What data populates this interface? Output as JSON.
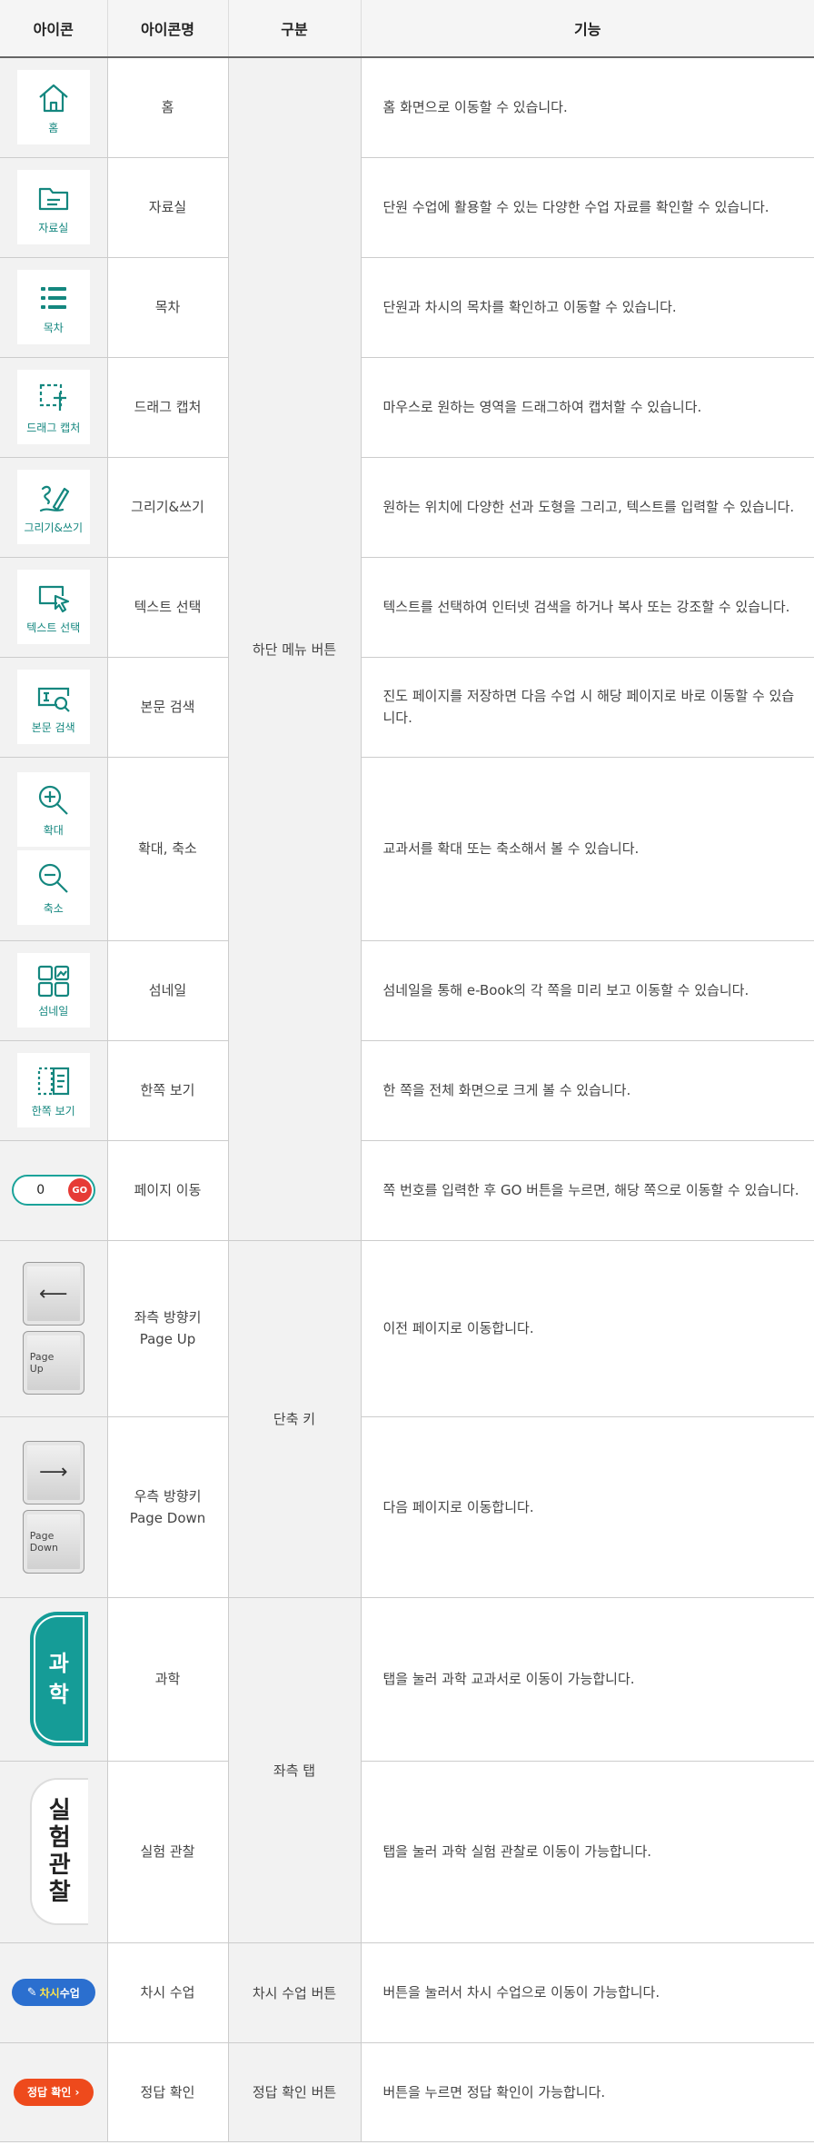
{
  "headers": {
    "icon": "아이콘",
    "name": "아이콘명",
    "category": "구분",
    "function": "기능"
  },
  "categories": {
    "bottom_menu": "하단 메뉴 버튼",
    "shortcut": "단축 키",
    "left_tab": "좌측 탭",
    "lesson": "차시 수업 버튼",
    "answer": "정답 확인 버튼"
  },
  "rows": [
    {
      "icon_label": "홈",
      "name": "홈",
      "desc": "홈 화면으로 이동할 수 있습니다.",
      "icon": "home-icon"
    },
    {
      "icon_label": "자료실",
      "name": "자료실",
      "desc": "단원 수업에 활용할 수 있는 다양한 수업 자료를 확인할 수 있습니다.",
      "icon": "folder-icon"
    },
    {
      "icon_label": "목차",
      "name": "목차",
      "desc": "단원과 차시의 목차를 확인하고 이동할 수 있습니다.",
      "icon": "list-icon"
    },
    {
      "icon_label": "드래그 캡처",
      "name": "드래그 캡처",
      "desc": "마우스로 원하는 영역을 드래그하여 캡처할 수 있습니다.",
      "icon": "crop-icon"
    },
    {
      "icon_label": "그리기&쓰기",
      "name": "그리기&쓰기",
      "desc": "원하는 위치에 다양한 선과 도형을 그리고, 텍스트를 입력할 수 있습니다.",
      "icon": "draw-icon"
    },
    {
      "icon_label": "텍스트 선택",
      "name": "텍스트 선택",
      "desc": "텍스트를 선택하여 인터넷 검색을 하거나 복사 또는 강조할 수 있습니다.",
      "icon": "text-select-icon"
    },
    {
      "icon_label": "본문 검색",
      "name": "본문 검색",
      "desc": "진도 페이지를 저장하면 다음 수업 시 해당 페이지로 바로 이동할 수 있습니다.",
      "icon": "search-text-icon"
    },
    {
      "icon_label": "확대",
      "icon_label2": "축소",
      "name": "확대, 축소",
      "desc": "교과서를 확대 또는 축소해서 볼 수 있습니다.",
      "icon": "zoom-in-icon",
      "icon2": "zoom-out-icon"
    },
    {
      "icon_label": "섬네일",
      "name": "섬네일",
      "desc": "섬네일을 통해 e-Book의 각 쪽을 미리 보고 이동할 수 있습니다.",
      "icon": "thumbnail-icon"
    },
    {
      "icon_label": "한쪽 보기",
      "name": "한쪽 보기",
      "desc": "한 쪽을 전체 화면으로 크게 볼 수 있습니다.",
      "icon": "single-page-icon"
    },
    {
      "name": "페이지 이동",
      "desc": "쪽 번호를 입력한 후 GO 버튼을 누르면, 해당 쪽으로 이동할 수 있습니다.",
      "page_value": "0",
      "go": "GO"
    }
  ],
  "keys": [
    {
      "name1": "좌측 방향키",
      "name2": "Page Up",
      "desc": "이전 페이지로 이동합니다.",
      "arrow": "⟵",
      "key_text1": "Page",
      "key_text2": "Up"
    },
    {
      "name1": "우측 방향키",
      "name2": "Page Down",
      "desc": "다음 페이지로 이동합니다.",
      "arrow": "⟶",
      "key_text1": "Page",
      "key_text2": "Down"
    }
  ],
  "tabs": [
    {
      "name": "과학",
      "desc": "탭을 눌러 과학 교과서로 이동이 가능합니다.",
      "tab_text": "과학"
    },
    {
      "name": "실험 관찰",
      "desc": "탭을 눌러 과학 실험 관찰로 이동이 가능합니다.",
      "tab_text": "실험관찰"
    }
  ],
  "lesson": {
    "pill_a": "차시",
    "pill_b": " 수업",
    "name": "차시 수업",
    "desc": "버튼을 눌러서 차시 수업으로 이동이 가능합니다."
  },
  "answer": {
    "pill": "정답 확인",
    "arrow": "›",
    "name": "정답 확인",
    "desc": "버튼을 누르면 정답 확인이 가능합니다."
  },
  "colors": {
    "teal": "#14877f",
    "tab_teal": "#159c97",
    "go_red": "#e63b36",
    "pill_blue": "#2b6fcf",
    "pill_red": "#ee4a1c"
  }
}
